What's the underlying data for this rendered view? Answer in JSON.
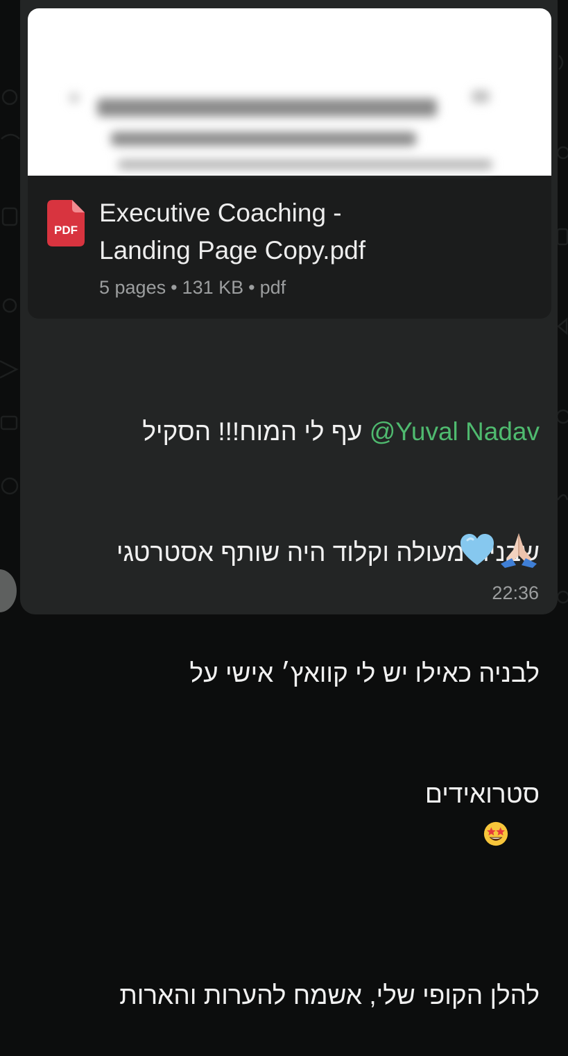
{
  "colors": {
    "background": "#0c0d0d",
    "bubble": "#232525",
    "mention": "#4fba6f",
    "pdf_red": "#d8343f"
  },
  "document": {
    "icon_label": "PDF",
    "title_line1": "Executive Coaching -",
    "title_line2": "Landing Page Copy.pdf",
    "pages": "5 pages",
    "size": "131 KB",
    "type": "pdf",
    "separator": "•",
    "preview": "blurred document preview"
  },
  "message": {
    "mention": "@Yuval Nadav",
    "line1_rest": " עף לי המוח!!! הסקיל",
    "line2": "שבנית מעולה וקלוד היה שותף אסטרטגי",
    "line3": "לבניה כאילו יש לי קוואץ׳ אישי על",
    "line4": "סטרואידים",
    "line5": "להלן הקופי שלי, אשמח להערות והארות",
    "emojis": [
      "star-struck-icon",
      "folded-hands-icon",
      "light-blue-heart-icon"
    ]
  },
  "timestamp": "22:36"
}
